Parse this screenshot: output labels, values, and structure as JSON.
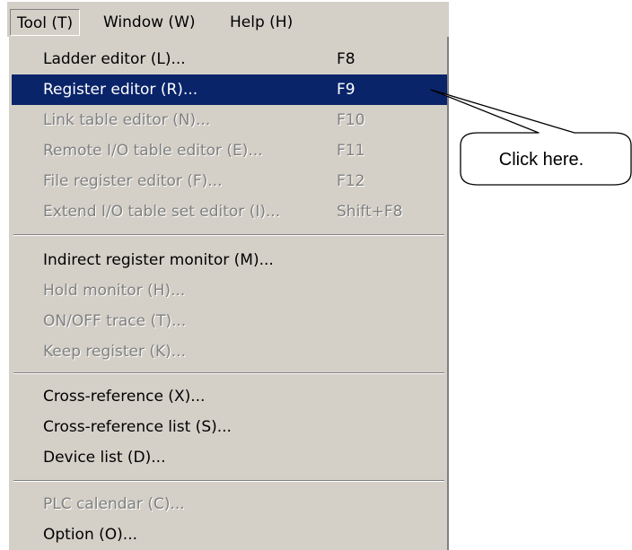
{
  "menubar": {
    "items": [
      {
        "label": "Tool (T)"
      },
      {
        "label": "Window (W)"
      },
      {
        "label": "Help (H)"
      }
    ]
  },
  "menu": {
    "items": [
      {
        "label": "Ladder editor (L)...",
        "shortcut": "F8",
        "state": "enabled"
      },
      {
        "label": "Register editor (R)...",
        "shortcut": "F9",
        "state": "selected"
      },
      {
        "label": "Link table editor (N)...",
        "shortcut": "F10",
        "state": "disabled"
      },
      {
        "label": "Remote I/O table editor (E)...",
        "shortcut": "F11",
        "state": "disabled"
      },
      {
        "label": "File register editor (F)...",
        "shortcut": "F12",
        "state": "disabled"
      },
      {
        "label": "Extend I/O table set editor (I)...",
        "shortcut": "Shift+F8",
        "state": "disabled"
      },
      {
        "label": "Indirect register monitor (M)...",
        "shortcut": "",
        "state": "enabled"
      },
      {
        "label": "Hold monitor (H)...",
        "shortcut": "",
        "state": "disabled"
      },
      {
        "label": "ON/OFF trace (T)...",
        "shortcut": "",
        "state": "disabled"
      },
      {
        "label": "Keep register (K)...",
        "shortcut": "",
        "state": "disabled"
      },
      {
        "label": "Cross-reference (X)...",
        "shortcut": "",
        "state": "enabled"
      },
      {
        "label": "Cross-reference list (S)...",
        "shortcut": "",
        "state": "enabled"
      },
      {
        "label": "Device list (D)...",
        "shortcut": "",
        "state": "enabled"
      },
      {
        "label": "PLC calendar (C)...",
        "shortcut": "",
        "state": "disabled"
      },
      {
        "label": "Option (O)...",
        "shortcut": "",
        "state": "enabled"
      }
    ]
  },
  "callout": {
    "text": "Click here."
  },
  "colors": {
    "menu_background": "#d4d0c8",
    "highlight": "#0a246a",
    "disabled_text": "#808080"
  }
}
